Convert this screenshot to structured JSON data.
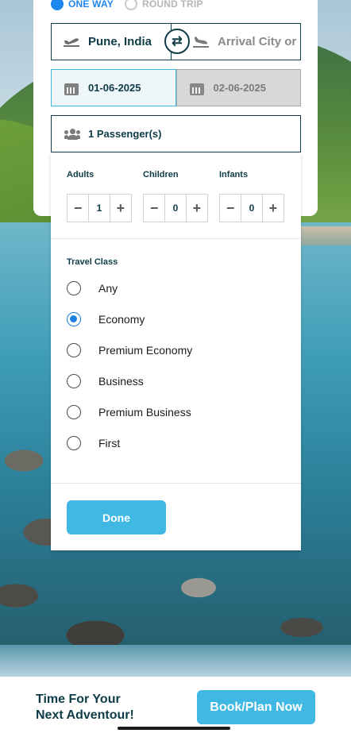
{
  "trip_type": {
    "options": [
      {
        "label": "ONE WAY",
        "selected": true
      },
      {
        "label": "ROUND TRIP",
        "selected": false
      }
    ]
  },
  "route": {
    "from": "Pune, India",
    "to_placeholder": "Arrival City or",
    "swap_icon": "swap-icon"
  },
  "dates": {
    "departure": "01-06-2025",
    "return": "02-06-2025"
  },
  "passengers": {
    "summary": "1 Passenger(s)",
    "groups": [
      {
        "label": "Adults",
        "value": "1"
      },
      {
        "label": "Children",
        "value": "0"
      },
      {
        "label": "Infants",
        "value": "0"
      }
    ]
  },
  "travel_class": {
    "title": "Travel Class",
    "options": [
      "Any",
      "Economy",
      "Premium Economy",
      "Business",
      "Premium Business",
      "First"
    ],
    "selected": "Economy"
  },
  "done_label": "Done",
  "footer": {
    "tagline_line1": "Time For Your",
    "tagline_line2": "Next Adventour!",
    "cta": "Book/Plan Now"
  },
  "colors": {
    "accent": "#3fb8e3",
    "radio_blue": "#1f86f0",
    "navy": "#0d3b47"
  }
}
